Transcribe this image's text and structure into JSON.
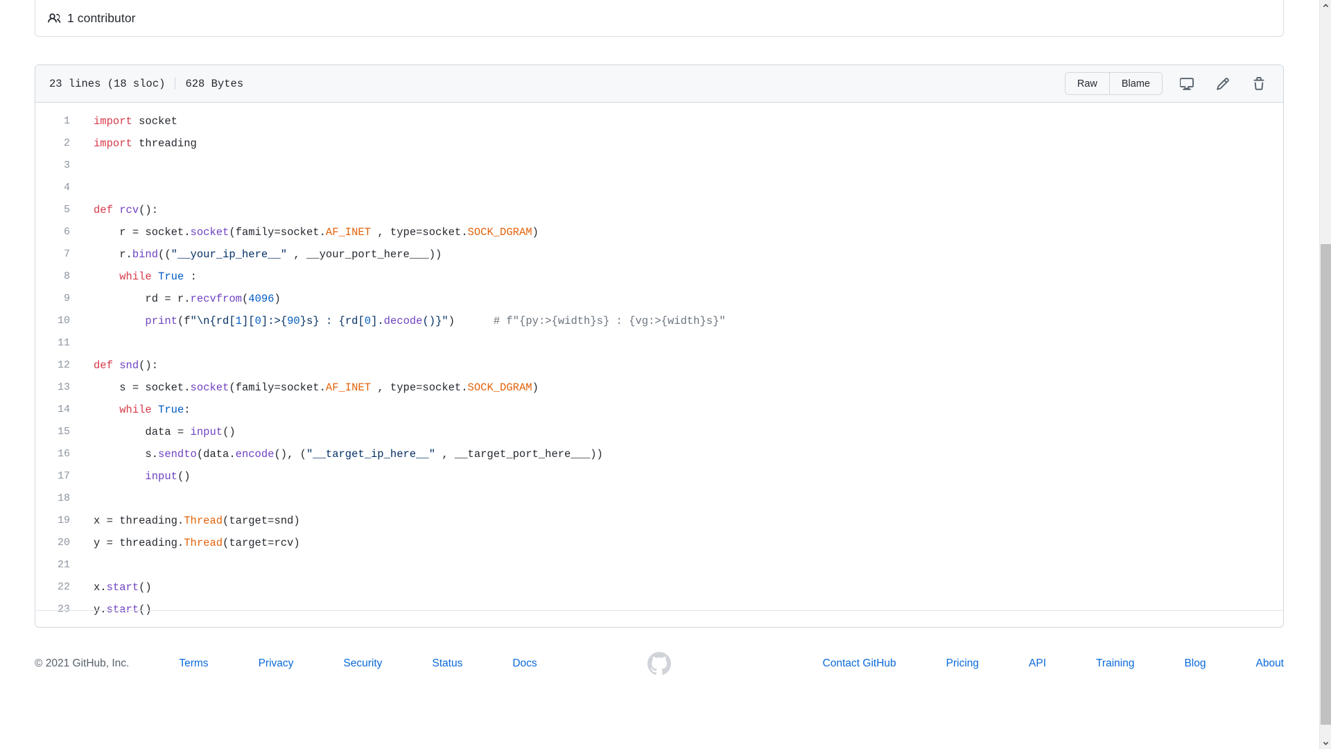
{
  "contributors": {
    "icon": "people-icon",
    "label": "1 contributor"
  },
  "file": {
    "lines_label": "23 lines (18 sloc)",
    "size_label": "628 Bytes",
    "actions": {
      "raw": "Raw",
      "blame": "Blame",
      "open_desktop_icon": "desktop-download-icon",
      "edit_icon": "pencil-icon",
      "delete_icon": "trash-icon"
    }
  },
  "code": {
    "language": "python",
    "line_numbers": [
      1,
      2,
      3,
      4,
      5,
      6,
      7,
      8,
      9,
      10,
      11,
      12,
      13,
      14,
      15,
      16,
      17,
      18,
      19,
      20,
      21,
      22,
      23
    ],
    "lines": [
      {
        "n": 1,
        "text": "import socket"
      },
      {
        "n": 2,
        "text": "import threading"
      },
      {
        "n": 3,
        "text": ""
      },
      {
        "n": 4,
        "text": ""
      },
      {
        "n": 5,
        "text": "def rcv():"
      },
      {
        "n": 6,
        "text": "    r = socket.socket(family=socket.AF_INET , type=socket.SOCK_DGRAM)"
      },
      {
        "n": 7,
        "text": "    r.bind((\"__your_ip_here__\" , __your_port_here___))"
      },
      {
        "n": 8,
        "text": "    while True :"
      },
      {
        "n": 9,
        "text": "        rd = r.recvfrom(4096)"
      },
      {
        "n": 10,
        "text": "        print(f\"\\n{rd[1][0]:>{90}s} : {rd[0].decode()}\")      # f\"{py:>{width}s} : {vg:>{width}s}\""
      },
      {
        "n": 11,
        "text": ""
      },
      {
        "n": 12,
        "text": "def snd():"
      },
      {
        "n": 13,
        "text": "    s = socket.socket(family=socket.AF_INET , type=socket.SOCK_DGRAM)"
      },
      {
        "n": 14,
        "text": "    while True:"
      },
      {
        "n": 15,
        "text": "        data = input()"
      },
      {
        "n": 16,
        "text": "        s.sendto(data.encode(), (\"__target_ip_here__\" , __target_port_here___))"
      },
      {
        "n": 17,
        "text": "        input()"
      },
      {
        "n": 18,
        "text": ""
      },
      {
        "n": 19,
        "text": "x = threading.Thread(target=snd)"
      },
      {
        "n": 20,
        "text": "y = threading.Thread(target=rcv)"
      },
      {
        "n": 21,
        "text": ""
      },
      {
        "n": 22,
        "text": "x.start()"
      },
      {
        "n": 23,
        "text": "y.start()"
      }
    ]
  },
  "footer": {
    "copyright": "© 2021 GitHub, Inc.",
    "left_links": [
      "Terms",
      "Privacy",
      "Security",
      "Status",
      "Docs"
    ],
    "logo_icon": "github-octocat-icon",
    "right_links": [
      "Contact GitHub",
      "Pricing",
      "API",
      "Training",
      "Blog",
      "About"
    ]
  },
  "scrollbar": {
    "up_icon": "chevron-up-icon",
    "down_icon": "chevron-down-icon"
  },
  "colors": {
    "link": "#0969da",
    "keyword": "#d73a49",
    "function": "#6f42c1",
    "class": "#e36209",
    "string": "#032f62",
    "number": "#005cc5",
    "comment": "#6a737d",
    "text": "#24292f",
    "border": "#d0d7de",
    "header_bg": "#f6f8fa"
  }
}
